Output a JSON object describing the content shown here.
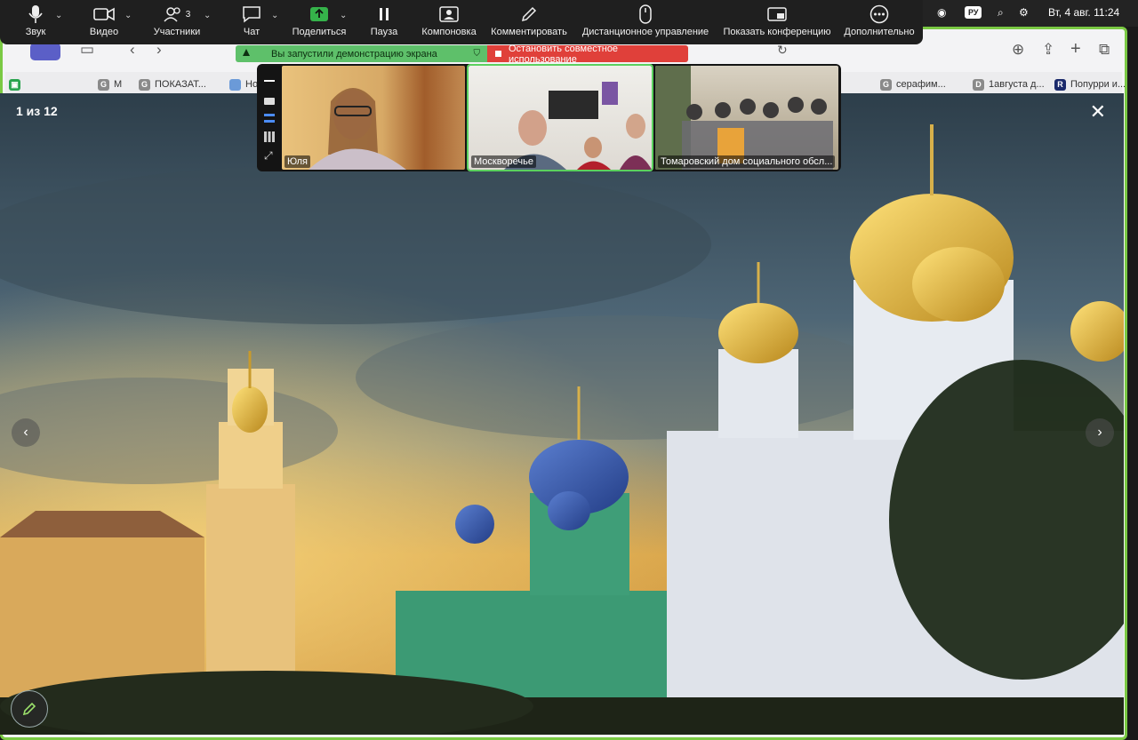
{
  "zoom_toolbar": {
    "items": [
      {
        "label": "Звук",
        "icon": "microphone-icon"
      },
      {
        "label": "Видео",
        "icon": "video-camera-icon"
      },
      {
        "label": "Участники",
        "icon": "participants-icon",
        "count": "3"
      },
      {
        "label": "Чат",
        "icon": "chat-icon"
      },
      {
        "label": "Поделиться",
        "icon": "share-screen-icon"
      },
      {
        "label": "Пауза",
        "icon": "pause-icon"
      },
      {
        "label": "Компоновка",
        "icon": "layout-icon"
      },
      {
        "label": "Комментировать",
        "icon": "pencil-icon"
      },
      {
        "label": "Дистанционное управление",
        "icon": "mouse-icon"
      },
      {
        "label": "Показать конференцию",
        "icon": "show-meeting-icon"
      },
      {
        "label": "Дополнительно",
        "icon": "more-icon"
      }
    ]
  },
  "menubar": {
    "lang": "РУ",
    "datetime": "Вт, 4 авг.  11:24"
  },
  "share_banner": {
    "text": "Вы запустили демонстрацию экрана",
    "stop_label": "Остановить совместное использование"
  },
  "browser_tabs": [
    {
      "fav": "G",
      "title": "М"
    },
    {
      "fav": "G",
      "title": "ПОКАЗАТ..."
    },
    {
      "fav": "",
      "title": "Нов"
    },
    {
      "fav": "G",
      "title": "серафим..."
    },
    {
      "fav": "D",
      "title": "1августа д..."
    },
    {
      "fav": "R",
      "title": "Попурри и..."
    }
  ],
  "video_tiles": [
    {
      "name": "Юля",
      "active": false
    },
    {
      "name": "Москворечье",
      "active": true
    },
    {
      "name": "Томаровский дом социального обсл...",
      "active": false
    }
  ],
  "viewer": {
    "counter": "1 из 12"
  },
  "colors": {
    "share_green": "#5ec06a",
    "stop_red": "#e0403a",
    "active_outline": "#5bd15e"
  }
}
